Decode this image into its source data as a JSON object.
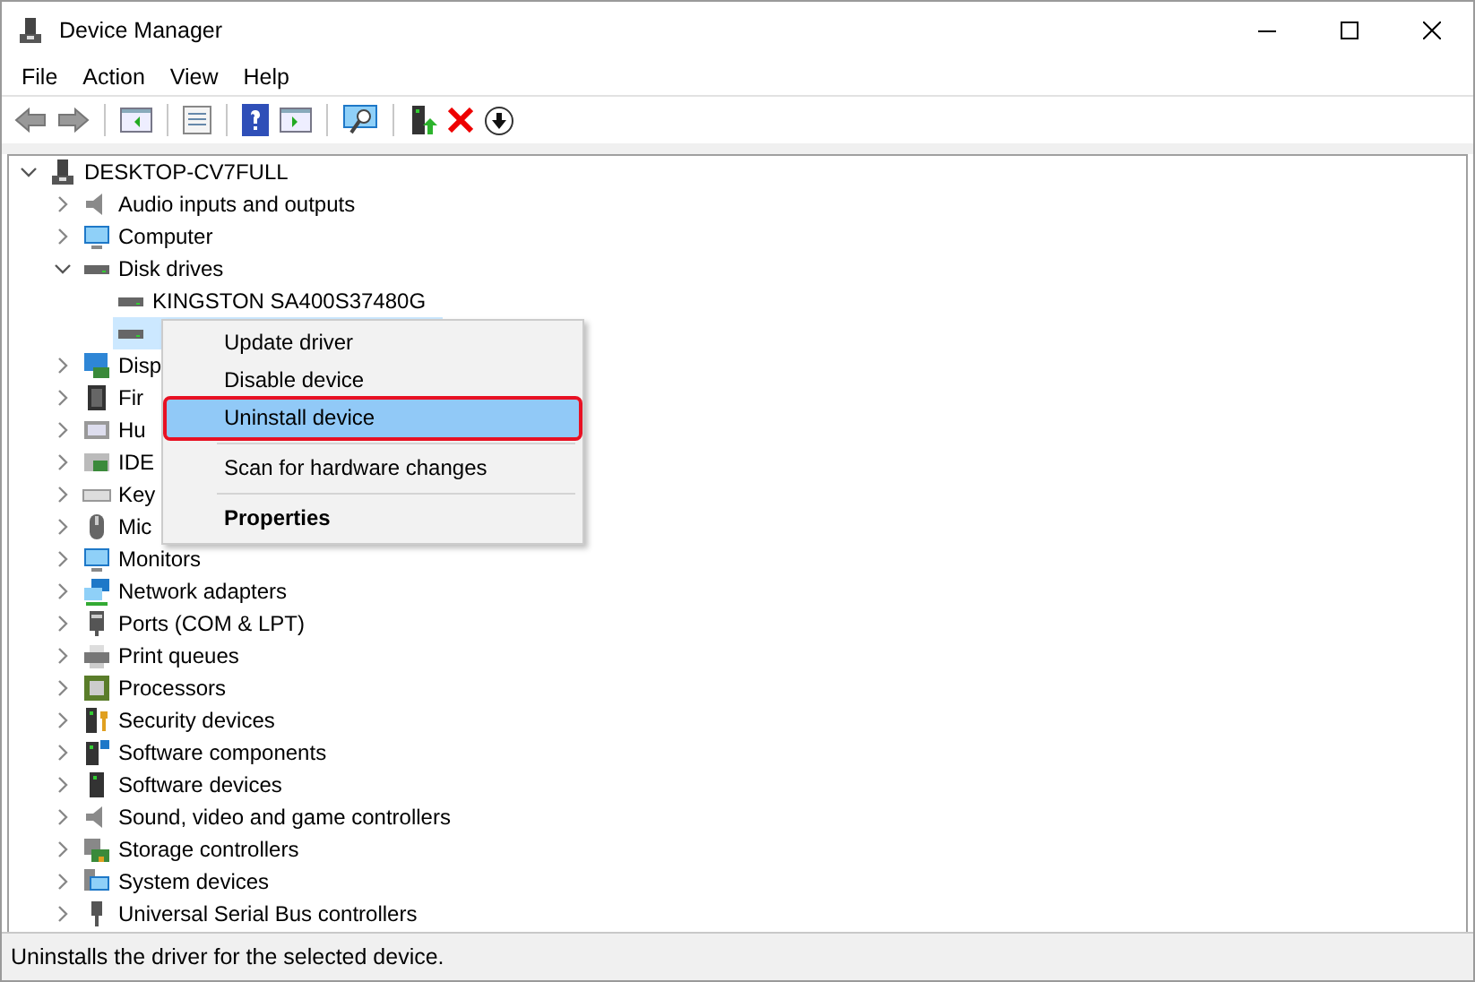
{
  "window": {
    "title": "Device Manager"
  },
  "menu_bar": [
    {
      "label": "File"
    },
    {
      "label": "Action"
    },
    {
      "label": "View"
    },
    {
      "label": "Help"
    }
  ],
  "tree": {
    "label": "DESKTOP-CV7FULL",
    "kind": "computer",
    "expanded": true,
    "selected": false,
    "children": [
      {
        "label": "Audio inputs and outputs",
        "kind": "audio",
        "expanded": false,
        "selected": false
      },
      {
        "label": "Computer",
        "kind": "monitor",
        "expanded": false,
        "selected": false
      },
      {
        "label": "Disk drives",
        "kind": "disk",
        "expanded": true,
        "selected": false,
        "children": [
          {
            "label": "KINGSTON SA400S37480G",
            "kind": "disk",
            "selected": false
          },
          {
            "kind": "disk",
            "selected": true
          }
        ]
      },
      {
        "label": "Disp",
        "kind": "display",
        "expanded": false,
        "selected": false
      },
      {
        "label": "Fir",
        "kind": "firmware",
        "expanded": false,
        "selected": false
      },
      {
        "label": "Hu",
        "kind": "hid",
        "expanded": false,
        "selected": false
      },
      {
        "label": "IDE",
        "kind": "ide",
        "expanded": false,
        "selected": false
      },
      {
        "label": "Key",
        "kind": "keyboard",
        "expanded": false,
        "selected": false
      },
      {
        "label": "Mic",
        "kind": "mouse",
        "expanded": false,
        "selected": false
      },
      {
        "label": "Monitors",
        "kind": "monitor",
        "expanded": false,
        "selected": false
      },
      {
        "label": "Network adapters",
        "kind": "network",
        "expanded": false,
        "selected": false
      },
      {
        "label": "Ports (COM & LPT)",
        "kind": "port",
        "expanded": false,
        "selected": false
      },
      {
        "label": "Print queues",
        "kind": "printer",
        "expanded": false,
        "selected": false
      },
      {
        "label": "Processors",
        "kind": "processor",
        "expanded": false,
        "selected": false
      },
      {
        "label": "Security devices",
        "kind": "security",
        "expanded": false,
        "selected": false
      },
      {
        "label": "Software components",
        "kind": "swcomponent",
        "expanded": false,
        "selected": false
      },
      {
        "label": "Software devices",
        "kind": "swdevice",
        "expanded": false,
        "selected": false
      },
      {
        "label": "Sound, video and game controllers",
        "kind": "audio",
        "expanded": false,
        "selected": false
      },
      {
        "label": "Storage controllers",
        "kind": "storage",
        "expanded": false,
        "selected": false
      },
      {
        "label": "System devices",
        "kind": "system",
        "expanded": false,
        "selected": false
      },
      {
        "label": "Universal Serial Bus controllers",
        "kind": "usb",
        "expanded": false,
        "selected": false
      }
    ]
  },
  "context_menu": {
    "items": [
      {
        "label": "Update driver",
        "kind": "item",
        "selected": false,
        "outlined": false,
        "divider_before": false
      },
      {
        "label": "Disable device",
        "kind": "item",
        "selected": false,
        "outlined": false,
        "divider_before": false
      },
      {
        "label": "Uninstall device",
        "kind": "item",
        "selected": true,
        "outlined": true,
        "divider_before": false
      },
      {
        "label": "Scan for hardware changes",
        "kind": "item",
        "selected": false,
        "outlined": false,
        "divider_before": true
      },
      {
        "label": "Properties",
        "kind": "default",
        "selected": false,
        "outlined": false,
        "divider_before": true
      }
    ]
  },
  "status_bar": {
    "text": "Uninstalls the driver for the selected device."
  }
}
